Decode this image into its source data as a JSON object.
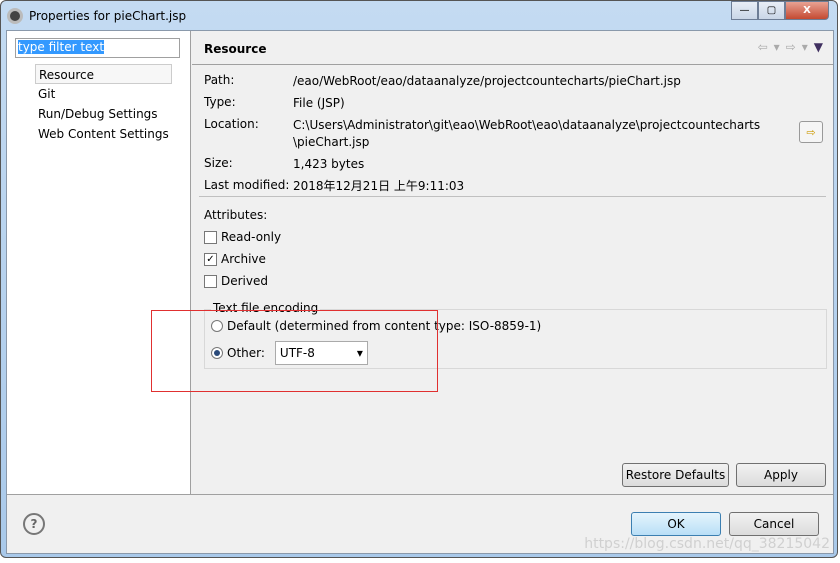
{
  "window": {
    "title": "Properties for pieChart.jsp",
    "minimize": "▭",
    "maximize": "▢",
    "close": "X"
  },
  "sidebar": {
    "filter_value": "type filter text",
    "items": [
      {
        "label": "Resource"
      },
      {
        "label": "Git"
      },
      {
        "label": "Run/Debug Settings"
      },
      {
        "label": "Web Content Settings"
      }
    ]
  },
  "page": {
    "title": "Resource",
    "fields": [
      {
        "key": "Path:",
        "value": "/eao/WebRoot/eao/dataanalyze/projectcountecharts/pieChart.jsp"
      },
      {
        "key": "Type:",
        "value": "File  (JSP)"
      },
      {
        "key": "Location:",
        "value": "C:\\Users\\Administrator\\git\\eao\\WebRoot\\eao\\dataanalyze\\projectcountecharts",
        "value2": "\\pieChart.jsp"
      },
      {
        "key": "Size:",
        "value": "1,423  bytes"
      },
      {
        "key": "Last modified:",
        "value": "2018年12月21日 上午9:11:03"
      }
    ],
    "attributes_label": "Attributes:",
    "attributes": [
      {
        "label": "Read-only",
        "checked": false
      },
      {
        "label": "Archive",
        "checked": true
      },
      {
        "label": "Derived",
        "checked": false
      }
    ],
    "encoding": {
      "legend": "Text file encoding",
      "default_label": "Default (determined from content type: ISO-8859-1)",
      "other_label": "Other:",
      "selected": "other",
      "other_value": "UTF-8"
    },
    "restore_defaults": "Restore Defaults",
    "apply": "Apply"
  },
  "footer": {
    "ok": "OK",
    "cancel": "Cancel",
    "help": "?"
  },
  "watermark": "https://blog.csdn.net/qq_38215042",
  "colors": {
    "highlight": "#e03030",
    "selection": "#3399ff"
  }
}
